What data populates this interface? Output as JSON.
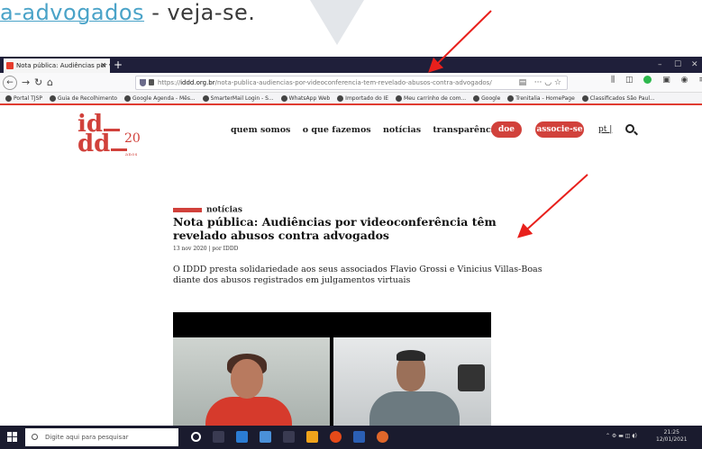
{
  "document": {
    "link_text": "a-advogados",
    "rest_text": " - veja-se."
  },
  "browser": {
    "tab_title": "Nota pública: Audiências por v",
    "url_prefix": "https://",
    "url_domain": "iddd.org.br",
    "url_path": "/nota-publica-audiencias-por-videoconferencia-tem-revelado-abusos-contra-advogados/",
    "bookmarks": [
      "Portal TJSP",
      "Guia de Recolhimento",
      "Google Agenda - Mês...",
      "SmarterMail Login - S...",
      "WhatsApp Web",
      "Importado do IE",
      "Meu carrinho de com...",
      "Google",
      "Trenitalia - HomePage",
      "Classificados São Paul..."
    ]
  },
  "site": {
    "logo_line1": "id",
    "logo_line2": "dd",
    "logo_anniv": "20",
    "logo_anos": "anos",
    "nav": [
      "quem somos",
      "o que fazemos",
      "notícias",
      "transparência"
    ],
    "donate_label": "doe",
    "join_label": "associe-se",
    "lang_label": "pt |"
  },
  "article": {
    "category": "notícias",
    "title": "Nota pública: Audiências por videoconferência têm revelado abusos contra advogados",
    "meta": "13 nov 2020 | por IDDD",
    "lead": "O IDDD presta solidariedade aos seus associados Flavio Grossi e Vinicius Villas-Boas diante dos abusos registrados em julgamentos virtuais"
  },
  "taskbar": {
    "search_placeholder": "Digite aqui para pesquisar",
    "time": "21:25",
    "date": "12/01/2021"
  },
  "colors": {
    "brand_red": "#d1413b",
    "arrow_red": "#e8201c",
    "taskbar_bg": "#1a1b2e"
  }
}
